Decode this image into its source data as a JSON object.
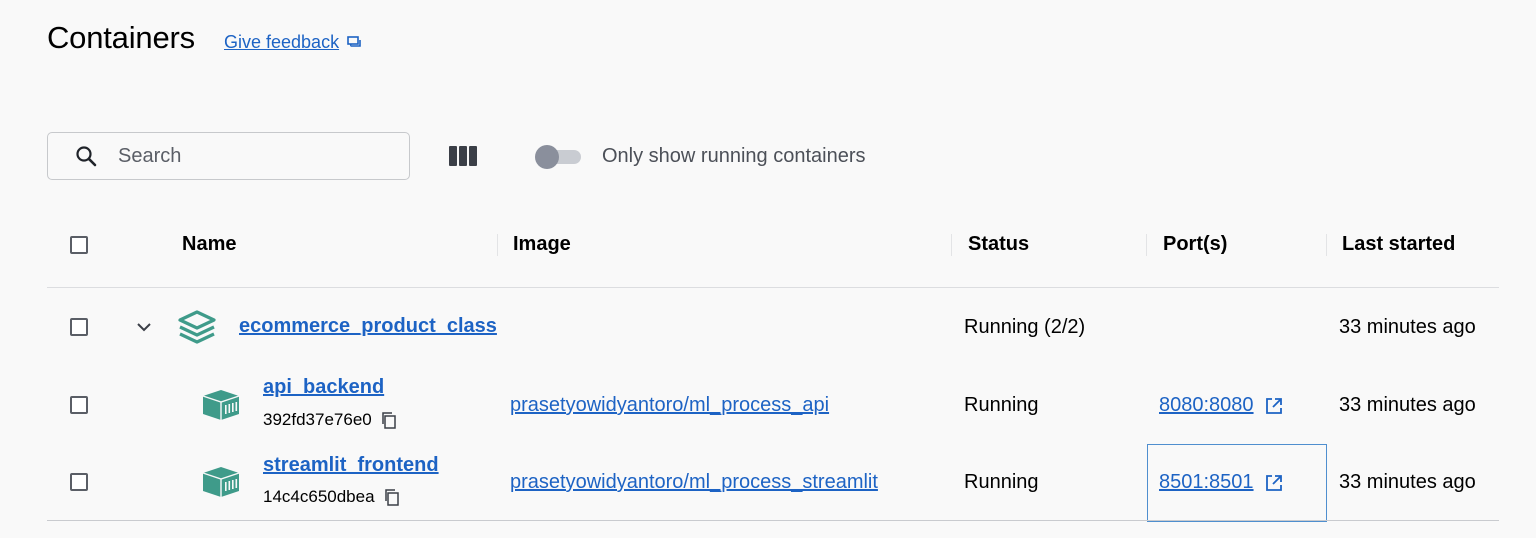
{
  "header": {
    "title": "Containers",
    "feedback_label": "Give feedback",
    "feedback_icon": "feedback-icon"
  },
  "toolbar": {
    "search_placeholder": "Search",
    "search_value": "",
    "columns_icon": "columns-icon",
    "toggle_label": "Only show running containers",
    "toggle_on": false
  },
  "table": {
    "columns": [
      "Name",
      "Image",
      "Status",
      "Port(s)",
      "Last started"
    ],
    "group": {
      "name": "ecommerce_product_class",
      "status": "Running (2/2)",
      "last_started": "33 minutes ago",
      "icon": "stack-icon",
      "expanded": true
    },
    "rows": [
      {
        "name": "api_backend",
        "id": "392fd37e76e0",
        "image": "prasetyowidyantoro/ml_process_api",
        "status": "Running",
        "port": "8080:8080",
        "last_started": "33 minutes ago"
      },
      {
        "name": "streamlit_frontend",
        "id": "14c4c650dbea",
        "image": "prasetyowidyantoro/ml_process_streamlit",
        "status": "Running",
        "port": "8501:8501",
        "last_started": "33 minutes ago"
      }
    ]
  },
  "colors": {
    "link": "#1d63c4",
    "container_icon": "#3f9b8a",
    "background": "#f9f9f9"
  }
}
